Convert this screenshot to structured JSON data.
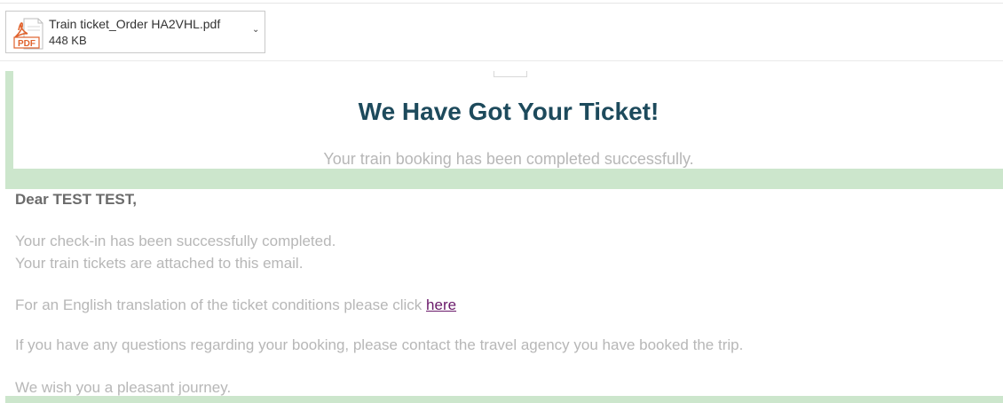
{
  "attachment": {
    "filename": "Train ticket_Order HA2VHL.pdf",
    "size": "448 KB",
    "icon_label": "PDF",
    "icon": "pdf-file-icon",
    "menu_icon": "chevron-down-icon"
  },
  "email": {
    "headline": "We Have Got Your Ticket!",
    "subheadline": "Your train booking has been completed successfully.",
    "greeting": "Dear TEST TEST,",
    "line1": "Your check-in has been successfully completed.",
    "line2": "Your train tickets are attached to this email.",
    "translation_text": "For an English translation of the ticket conditions please click ",
    "translation_link": "here",
    "questions": "If you have any questions regarding your booking, please contact the travel agency you have booked the trip.",
    "closing": "We wish you a pleasant journey."
  },
  "colors": {
    "accent_green": "#cce6cc",
    "headline": "#1d4a5c",
    "body_text": "#b7b7b7",
    "link": "#6a1a6a",
    "pdf_red": "#e0622c"
  }
}
